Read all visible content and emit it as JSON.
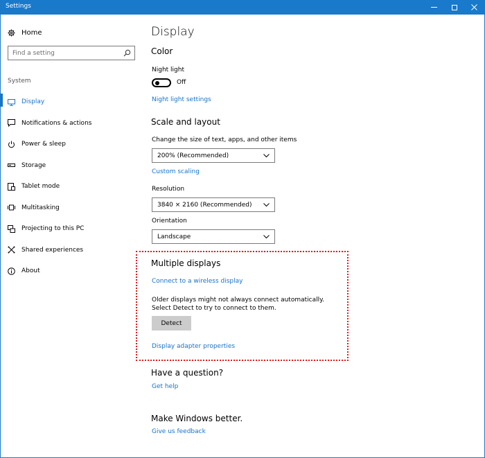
{
  "window": {
    "title": "Settings"
  },
  "sidebar": {
    "home_label": "Home",
    "search_placeholder": "Find a setting",
    "section_label": "System",
    "items": [
      {
        "label": "Display",
        "icon": "monitor-icon",
        "active": true
      },
      {
        "label": "Notifications & actions",
        "icon": "notifications-icon",
        "active": false
      },
      {
        "label": "Power & sleep",
        "icon": "power-icon",
        "active": false
      },
      {
        "label": "Storage",
        "icon": "storage-icon",
        "active": false
      },
      {
        "label": "Tablet mode",
        "icon": "tablet-icon",
        "active": false
      },
      {
        "label": "Multitasking",
        "icon": "multitasking-icon",
        "active": false
      },
      {
        "label": "Projecting to this PC",
        "icon": "projecting-icon",
        "active": false
      },
      {
        "label": "Shared experiences",
        "icon": "shared-icon",
        "active": false
      },
      {
        "label": "About",
        "icon": "info-icon",
        "active": false
      }
    ]
  },
  "main": {
    "title": "Display",
    "color": {
      "heading": "Color",
      "night_light_label": "Night light",
      "night_light_state": "Off",
      "night_light_settings_link": "Night light settings"
    },
    "scale": {
      "heading": "Scale and layout",
      "size_label": "Change the size of text, apps, and other items",
      "size_value": "200% (Recommended)",
      "custom_scaling_link": "Custom scaling",
      "resolution_label": "Resolution",
      "resolution_value": "3840 × 2160 (Recommended)",
      "orientation_label": "Orientation",
      "orientation_value": "Landscape"
    },
    "multiple": {
      "heading": "Multiple displays",
      "wireless_link": "Connect to a wireless display",
      "description": "Older displays might not always connect automatically. Select Detect to try to connect to them.",
      "detect_label": "Detect",
      "adapter_link": "Display adapter properties"
    },
    "question": {
      "heading": "Have a question?",
      "link": "Get help"
    },
    "better": {
      "heading": "Make Windows better.",
      "link": "Give us feedback"
    }
  },
  "colors": {
    "accent": "#1872c8",
    "titlebar": "#1979ca",
    "highlight": "#e21a1a"
  }
}
